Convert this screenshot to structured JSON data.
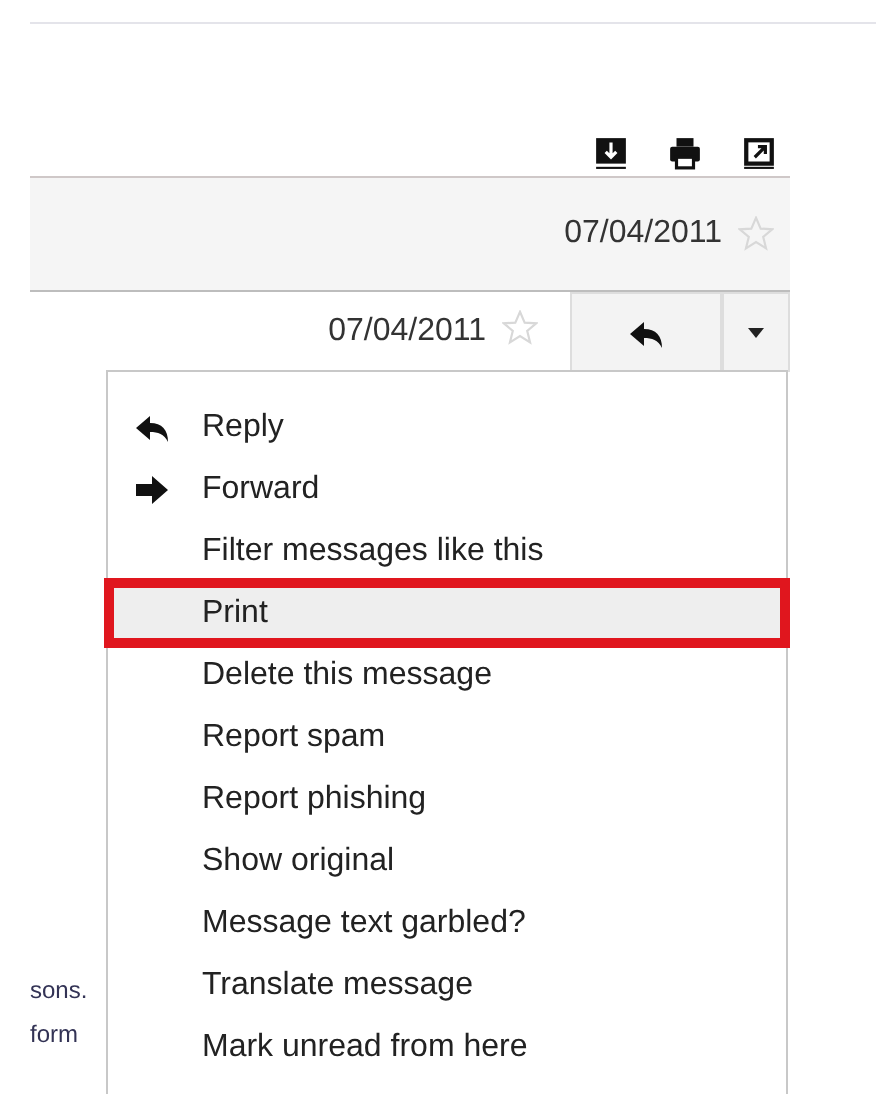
{
  "header": {
    "date": "07/04/2011",
    "starred": false
  },
  "message": {
    "date": "07/04/2011",
    "starred": false
  },
  "side_text": [
    "sons.",
    "form"
  ],
  "menu": [
    {
      "label": "Reply",
      "kind": "reply",
      "selected": false,
      "annotated": false
    },
    {
      "label": "Forward",
      "kind": "forward",
      "selected": false,
      "annotated": false
    },
    {
      "label": "Filter messages like this",
      "kind": "plain",
      "selected": false,
      "annotated": false
    },
    {
      "label": "Print",
      "kind": "plain",
      "selected": true,
      "annotated": true
    },
    {
      "label": "Delete this message",
      "kind": "plain",
      "selected": false,
      "annotated": false
    },
    {
      "label": "Report spam",
      "kind": "plain",
      "selected": false,
      "annotated": false
    },
    {
      "label": "Report phishing",
      "kind": "plain",
      "selected": false,
      "annotated": false
    },
    {
      "label": "Show original",
      "kind": "plain",
      "selected": false,
      "annotated": false
    },
    {
      "label": "Message text garbled?",
      "kind": "plain",
      "selected": false,
      "annotated": false
    },
    {
      "label": "Translate message",
      "kind": "plain",
      "selected": false,
      "annotated": false
    },
    {
      "label": "Mark unread from here",
      "kind": "plain",
      "selected": false,
      "annotated": false
    }
  ]
}
